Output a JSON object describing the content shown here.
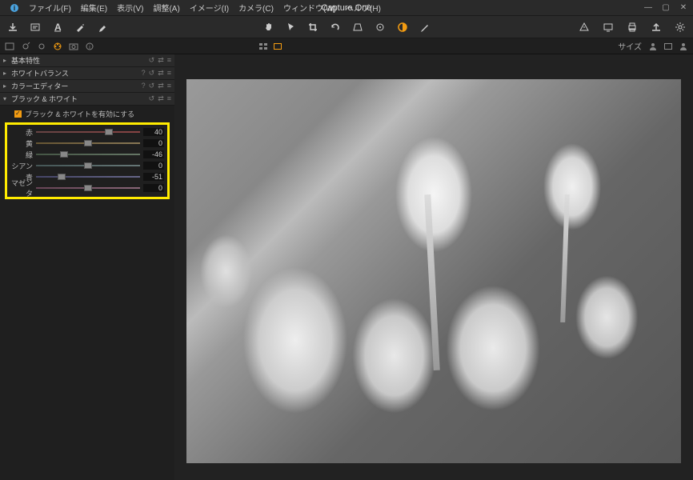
{
  "app": {
    "title": "Capture One"
  },
  "menu": {
    "file": "ファイル(F)",
    "edit": "編集(E)",
    "view": "表示(V)",
    "adjust": "調整(A)",
    "image": "イメージ(I)",
    "camera": "カメラ(C)",
    "window": "ウィンドウ(W)",
    "help": "ヘルプ(H)"
  },
  "sidebar": {
    "panels": [
      {
        "title": "基本特性",
        "expanded": false,
        "help": true
      },
      {
        "title": "ホワイトバランス",
        "expanded": false,
        "help": true
      },
      {
        "title": "カラーエディター",
        "expanded": false,
        "help": true
      },
      {
        "title": "ブラック & ホワイト",
        "expanded": true,
        "help": false
      }
    ],
    "bw": {
      "checkbox_label": "ブラック & ホワイトを有効にする",
      "sliders": [
        {
          "label": "赤",
          "value": 40,
          "color": "red"
        },
        {
          "label": "黄",
          "value": 0,
          "color": "yellow"
        },
        {
          "label": "緑",
          "value": -46,
          "color": "green"
        },
        {
          "label": "シアン",
          "value": 0,
          "color": "cyan"
        },
        {
          "label": "青",
          "value": -51,
          "color": "blue"
        },
        {
          "label": "マゼンタ",
          "value": 0,
          "color": "magenta"
        }
      ]
    }
  },
  "viewer_controls": {
    "size_label": "サイズ"
  }
}
